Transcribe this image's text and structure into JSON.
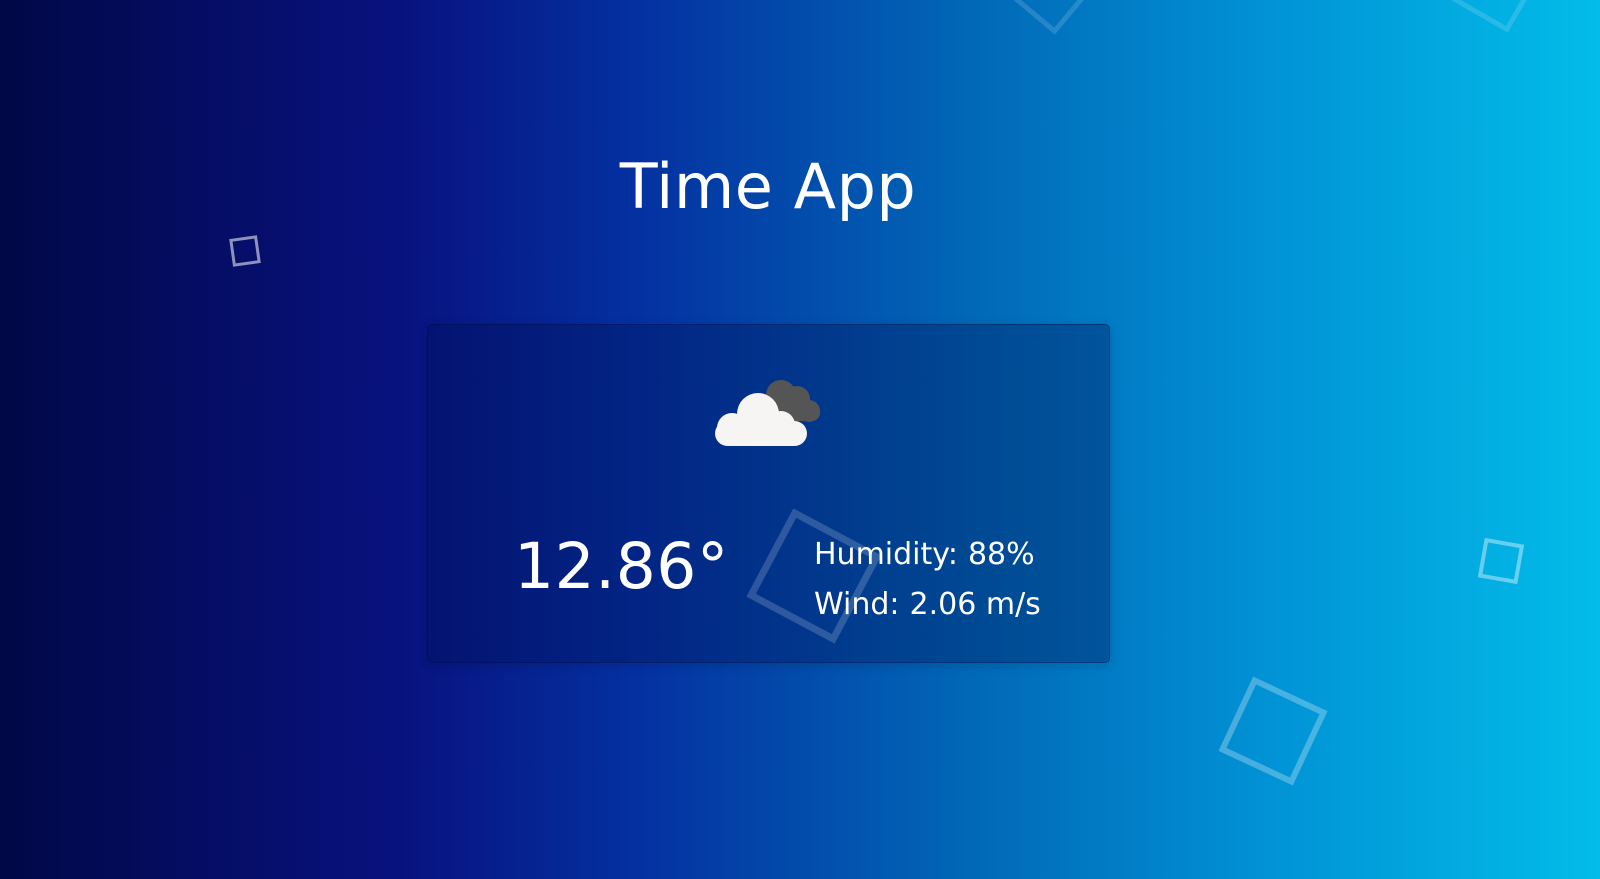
{
  "app": {
    "title": "Time App"
  },
  "weather": {
    "icon": "cloudy-icon",
    "temperature": "12.86°",
    "humidity_label": "Humidity:",
    "humidity_value": "88%",
    "wind_label": "Wind:",
    "wind_value": "2.06 m/s"
  },
  "colors": {
    "gradient_start": "#010847",
    "gradient_end": "#02bce9",
    "text": "#ffffff"
  }
}
